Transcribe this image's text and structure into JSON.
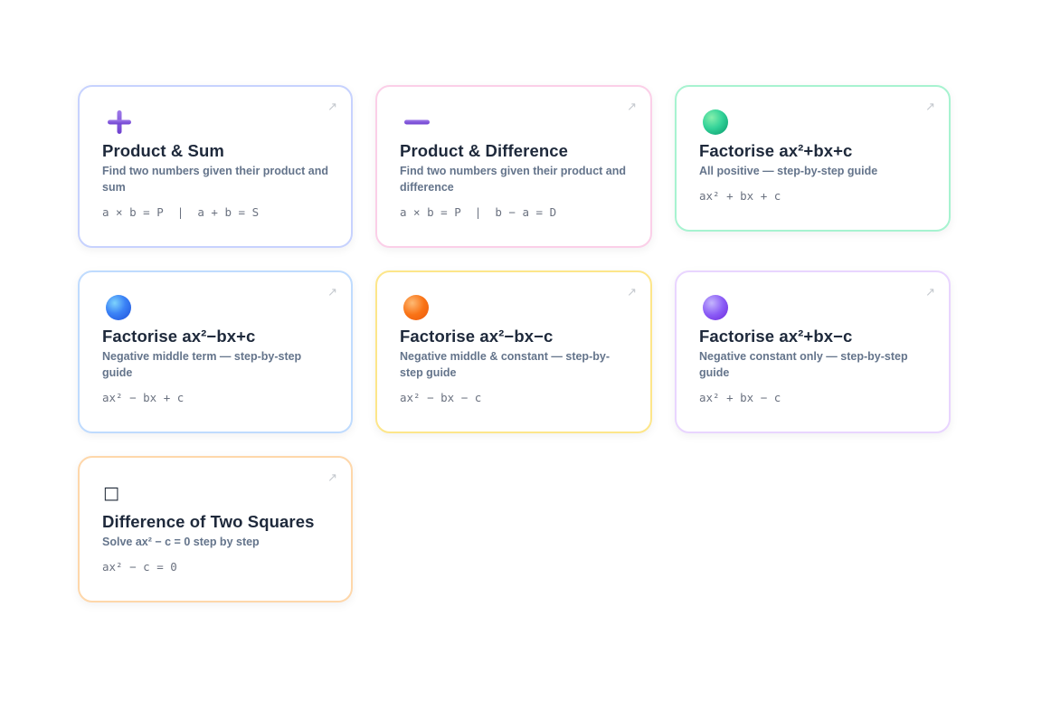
{
  "cards": [
    {
      "title": "Product & Sum",
      "description": "Find two numbers given their product and sum",
      "formula": "a × b = P  |  a + b = S",
      "icon": "plus-icon",
      "arrow": "↗",
      "accent": "#c7d2fe",
      "icon_color": "#7c4ddc"
    },
    {
      "title": "Product & Difference",
      "description": "Find two numbers given their product and difference",
      "formula": "a × b = P  |  b − a = D",
      "icon": "minus-icon",
      "arrow": "↗",
      "accent": "#fbcfe8",
      "icon_color": "#7c4ddc"
    },
    {
      "title": "Factorise ax²+bx+c",
      "description": "All positive — step-by-step guide",
      "formula": "ax² + bx + c",
      "icon": "green-circle-icon",
      "arrow": "↗",
      "accent": "#a7f3d0",
      "icon_color": "#34d399"
    },
    {
      "title": "Factorise ax²−bx+c",
      "description": "Negative middle term — step-by-step guide",
      "formula": "ax² − bx + c",
      "icon": "blue-circle-icon",
      "arrow": "↗",
      "accent": "#bfdbfe",
      "icon_color": "#3b82f6"
    },
    {
      "title": "Factorise ax²−bx−c",
      "description": "Negative middle & constant — step-by-step guide",
      "formula": "ax² − bx − c",
      "icon": "orange-circle-icon",
      "arrow": "↗",
      "accent": "#fde68a",
      "icon_color": "#f97316"
    },
    {
      "title": "Factorise ax²+bx−c",
      "description": "Negative constant only — step-by-step guide",
      "formula": "ax² + bx − c",
      "icon": "purple-circle-icon",
      "arrow": "↗",
      "accent": "#e9d5ff",
      "icon_color": "#8b5cf6"
    },
    {
      "title": "Difference of Two Squares",
      "description": "Solve ax² − c = 0 step by step",
      "formula": "ax² − c = 0",
      "icon": "square-icon",
      "icon_glyph": "□",
      "arrow": "↗",
      "accent": "#fed7aa",
      "icon_color": "#1f2937"
    }
  ]
}
